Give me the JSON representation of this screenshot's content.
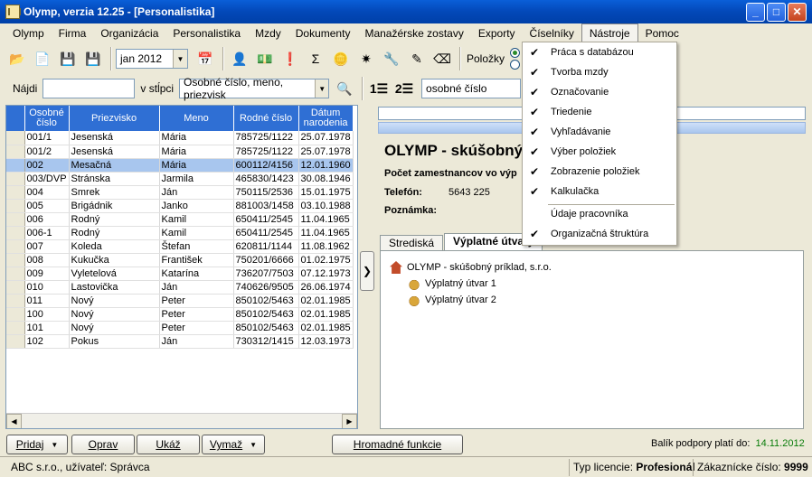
{
  "window": {
    "title": "Olymp, verzia 12.25 - [Personalistika]"
  },
  "menu": [
    "Olymp",
    "Firma",
    "Organizácia",
    "Personalistika",
    "Mzdy",
    "Dokumenty",
    "Manažérske zostavy",
    "Exporty",
    "Číselníky",
    "Nástroje",
    "Pomoc"
  ],
  "toolbar": {
    "period": "jan 2012",
    "items_label": "Položky"
  },
  "search": {
    "label": "Nájdi",
    "value": "",
    "column_label": "v stĺpci",
    "column_value": "Osobné číslo, meno, priezvisk",
    "sort_value": "osobné číslo"
  },
  "grid": {
    "headers": [
      "Osobné číslo",
      "Priezvisko",
      "Meno",
      "Rodné číslo",
      "Dátum narodenia"
    ],
    "rows": [
      [
        "001/1",
        "Jesenská",
        "Mária",
        "785725/1122",
        "25.07.1978"
      ],
      [
        "001/2",
        "Jesenská",
        "Mária",
        "785725/1122",
        "25.07.1978"
      ],
      [
        "002",
        "Mesačná",
        "Mária",
        "600112/4156",
        "12.01.1960"
      ],
      [
        "003/DVP",
        "Stránska",
        "Jarmila",
        "465830/1423",
        "30.08.1946"
      ],
      [
        "004",
        "Smrek",
        "Ján",
        "750115/2536",
        "15.01.1975"
      ],
      [
        "005",
        "Brigádnik",
        "Janko",
        "881003/1458",
        "03.10.1988"
      ],
      [
        "006",
        "Rodný",
        "Kamil",
        "650411/2545",
        "11.04.1965"
      ],
      [
        "006-1",
        "Rodný",
        "Kamil",
        "650411/2545",
        "11.04.1965"
      ],
      [
        "007",
        "Koleda",
        "Štefan",
        "620811/1144",
        "11.08.1962"
      ],
      [
        "008",
        "Kukučka",
        "František",
        "750201/6666",
        "01.02.1975"
      ],
      [
        "009",
        "Vyletelová",
        "Katarína",
        "736207/7503",
        "07.12.1973"
      ],
      [
        "010",
        "Lastovička",
        "Ján",
        "740626/9505",
        "26.06.1974"
      ],
      [
        "011",
        "Nový",
        "Peter",
        "850102/5463",
        "02.01.1985"
      ],
      [
        "100",
        "Nový",
        "Peter",
        "850102/5463",
        "02.01.1985"
      ],
      [
        "101",
        "Nový",
        "Peter",
        "850102/5463",
        "02.01.1985"
      ],
      [
        "102",
        "Pokus",
        "Ján",
        "730312/1415",
        "12.03.1973"
      ]
    ],
    "selected_row": 2
  },
  "detail": {
    "title": "OLYMP - skúšobný p",
    "count_label": "Počet zamestnancov vo výp",
    "phone_label": "Telefón:",
    "phone_value": "5643 225",
    "note_label": "Poznámka:"
  },
  "tabs": [
    "Strediská",
    "Výplatné útvary"
  ],
  "tree": {
    "root": "OLYMP - skúšobný príklad, s.r.o.",
    "children": [
      "Výplatný útvar 1",
      "Výplatný útvar 2"
    ]
  },
  "buttons": {
    "add": "Pridaj",
    "edit": "Oprav",
    "show": "Ukáž",
    "delete": "Vymaž",
    "bulk": "Hromadné funkcie"
  },
  "support": {
    "label": "Balík podpory platí do:",
    "date": "14.11.2012"
  },
  "status": {
    "company": "ABC s.r.o., užívateľ: Správca",
    "license_label": "Typ licencie:",
    "license": "Profesionál",
    "customer_label": "Zákaznícke číslo:",
    "customer": "9999"
  },
  "dropdown": {
    "items": [
      {
        "label": "Práca s databázou",
        "checked": true
      },
      {
        "label": "Tvorba mzdy",
        "checked": true
      },
      {
        "label": "Označovanie",
        "checked": true
      },
      {
        "label": "Triedenie",
        "checked": true
      },
      {
        "label": "Vyhľadávanie",
        "checked": true
      },
      {
        "label": "Výber položiek",
        "checked": true
      },
      {
        "label": "Zobrazenie položiek",
        "checked": true
      },
      {
        "label": "Kalkulačka",
        "checked": true
      },
      {
        "label": "Údaje pracovníka",
        "checked": false
      },
      {
        "label": "Organizačná štruktúra",
        "checked": true
      }
    ]
  }
}
